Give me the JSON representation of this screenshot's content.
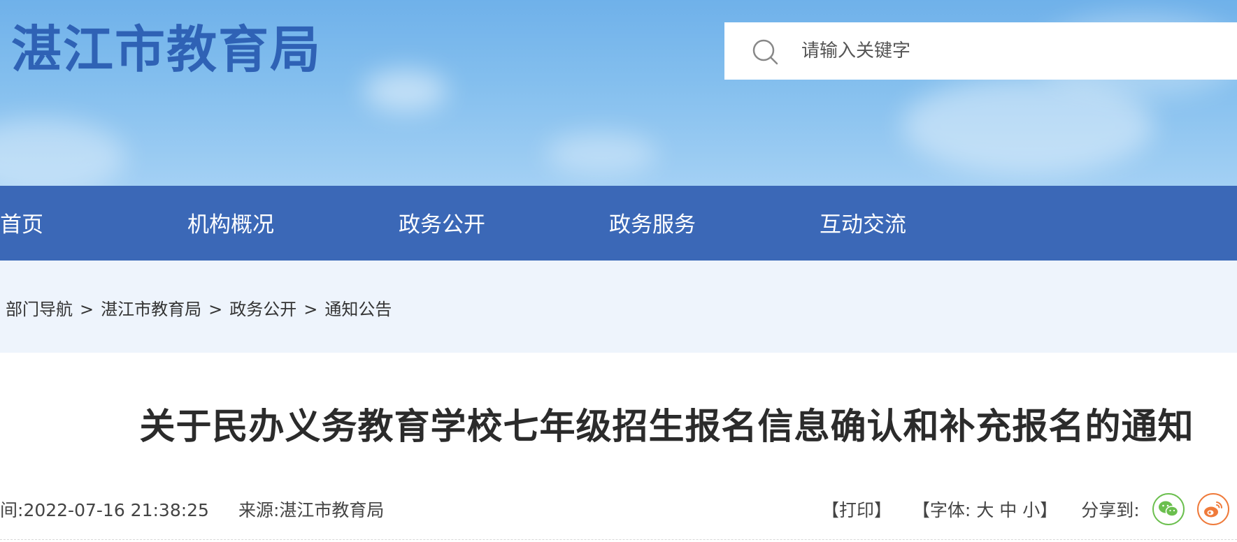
{
  "header": {
    "site_title": "湛江市教育局",
    "search_placeholder": "请输入关键字",
    "search_icon": "search-icon",
    "colors": {
      "title": "#2f62b5",
      "sky_top": "#6fb1ea",
      "sky_bottom": "#a3d0f4"
    }
  },
  "nav": {
    "color": "#3b68b7",
    "items": [
      {
        "label": "首页"
      },
      {
        "label": "机构概况"
      },
      {
        "label": "政务公开"
      },
      {
        "label": "政务服务"
      },
      {
        "label": "互动交流"
      }
    ]
  },
  "breadcrumb": {
    "items": [
      "部门导航",
      "湛江市教育局",
      "政务公开",
      "通知公告"
    ],
    "separator": ">"
  },
  "article": {
    "title": "关于民办义务教育学校七年级招生报名信息确认和补充报名的通知",
    "time_label": "间:",
    "time_value": "2022-07-16 21:38:25",
    "source_label": "来源:",
    "source_value": "湛江市教育局",
    "print_label": "【打印】",
    "font_label": "【字体:",
    "font_large": "大",
    "font_medium": "中",
    "font_small": "小",
    "font_close": "】",
    "share_label": "分享到:",
    "share_icons": [
      "wechat-icon",
      "weibo-icon"
    ]
  }
}
